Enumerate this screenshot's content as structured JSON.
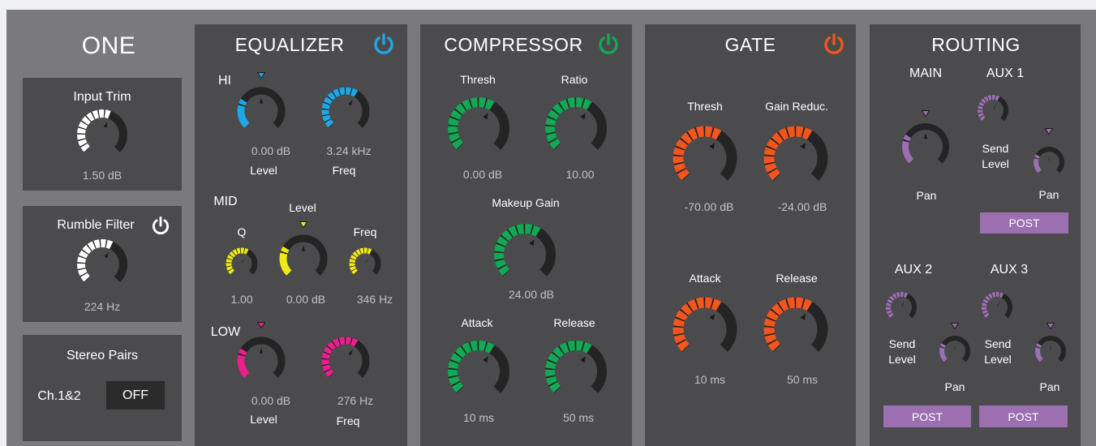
{
  "colors": {
    "background": "#7a7a7c",
    "panel": "#4b4b4d",
    "hi": "#1ea7e6",
    "mid": "#f0e817",
    "low": "#ea1f8e",
    "compressor": "#13a756",
    "gate": "#f2561e",
    "routing": "#9b6fb0",
    "trim": "#ffffff",
    "arc_off": "#242424"
  },
  "channel": {
    "name": "ONE",
    "input_trim": {
      "label": "Input Trim",
      "value": "1.50 dB",
      "level": 0.58
    },
    "rumble_filter": {
      "label": "Rumble Filter",
      "value": "224 Hz",
      "level": 0.6,
      "icon": "power-icon"
    },
    "stereo_pairs": {
      "label": "Stereo Pairs",
      "pair": "Ch.1&2",
      "state": "OFF"
    }
  },
  "equalizer": {
    "title": "EQUALIZER",
    "icon": "power-icon",
    "hi": {
      "band": "HI",
      "level_value": "0.00 dB",
      "level_label": "Level",
      "level": 0.5,
      "freq_value": "3.24 kHz",
      "freq_label": "Freq",
      "freq": 0.62
    },
    "mid": {
      "band": "MID",
      "q_label": "Q",
      "q_value": "1.00",
      "q": 0.6,
      "level_label": "Level",
      "level_value": "0.00 dB",
      "level": 0.5,
      "freq_label": "Freq",
      "freq_value": "346 Hz",
      "freq": 0.6
    },
    "low": {
      "band": "LOW",
      "level_value": "0.00 dB",
      "level_label": "Level",
      "level": 0.5,
      "freq_value": "276 Hz",
      "freq_label": "Freq",
      "freq": 0.62
    }
  },
  "compressor": {
    "title": "COMPRESSOR",
    "icon": "power-icon",
    "thresh": {
      "label": "Thresh",
      "value": "0.00 dB",
      "level": 0.62
    },
    "ratio": {
      "label": "Ratio",
      "value": "10.00",
      "level": 0.62
    },
    "makeup": {
      "label": "Makeup Gain",
      "value": "24.00 dB",
      "level": 0.62
    },
    "attack": {
      "label": "Attack",
      "value": "10 ms",
      "level": 0.62
    },
    "release": {
      "label": "Release",
      "value": "50 ms",
      "level": 0.62
    }
  },
  "gate": {
    "title": "GATE",
    "icon": "power-icon",
    "thresh": {
      "label": "Thresh",
      "value": "-70.00 dB",
      "level": 0.62
    },
    "gain_reduc": {
      "label": "Gain Reduc.",
      "value": "-24.00 dB",
      "level": 0.62
    },
    "attack": {
      "label": "Attack",
      "value": "10 ms",
      "level": 0.62
    },
    "release": {
      "label": "Release",
      "value": "50 ms",
      "level": 0.62
    }
  },
  "routing": {
    "title": "ROUTING",
    "main": {
      "title": "MAIN",
      "pan_label": "Pan",
      "pan": 0.5
    },
    "aux1": {
      "title": "AUX 1",
      "send_label_1": "Send",
      "send_label_2": "Level",
      "send": 0.6,
      "pan_label": "Pan",
      "pan": 0.5,
      "post": "POST"
    },
    "aux2": {
      "title": "AUX 2",
      "send_label_1": "Send",
      "send_label_2": "Level",
      "send": 0.6,
      "pan_label": "Pan",
      "pan": 0.5,
      "post": "POST"
    },
    "aux3": {
      "title": "AUX 3",
      "send_label_1": "Send",
      "send_label_2": "Level",
      "send": 0.6,
      "pan_label": "Pan",
      "pan": 0.5,
      "post": "POST"
    }
  }
}
